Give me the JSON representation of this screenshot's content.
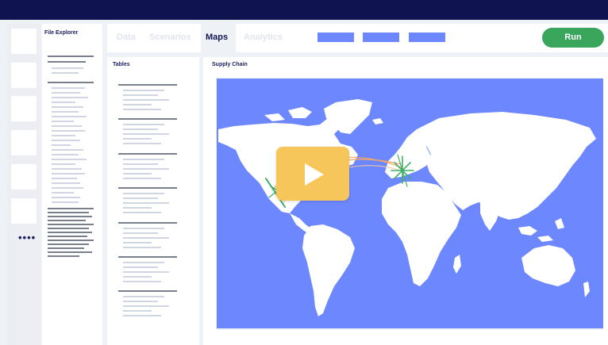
{
  "explorer": {
    "title": "File Explorer"
  },
  "tabs": [
    {
      "label": "Data"
    },
    {
      "label": "Scenarios"
    },
    {
      "label": "Maps"
    },
    {
      "label": "Analytics"
    }
  ],
  "run_label": "Run",
  "tables": {
    "title": "Tables"
  },
  "map": {
    "title": "Supply Chain"
  },
  "colors": {
    "accent": "#6d87ff",
    "run": "#3aa65b",
    "navy": "#0f1450",
    "play": "#f7c65a",
    "routes_green": "#3fae66",
    "routes_orange": "#f2a66a"
  },
  "icons": {
    "more": "more-horizontal-icon",
    "play": "play-icon"
  }
}
